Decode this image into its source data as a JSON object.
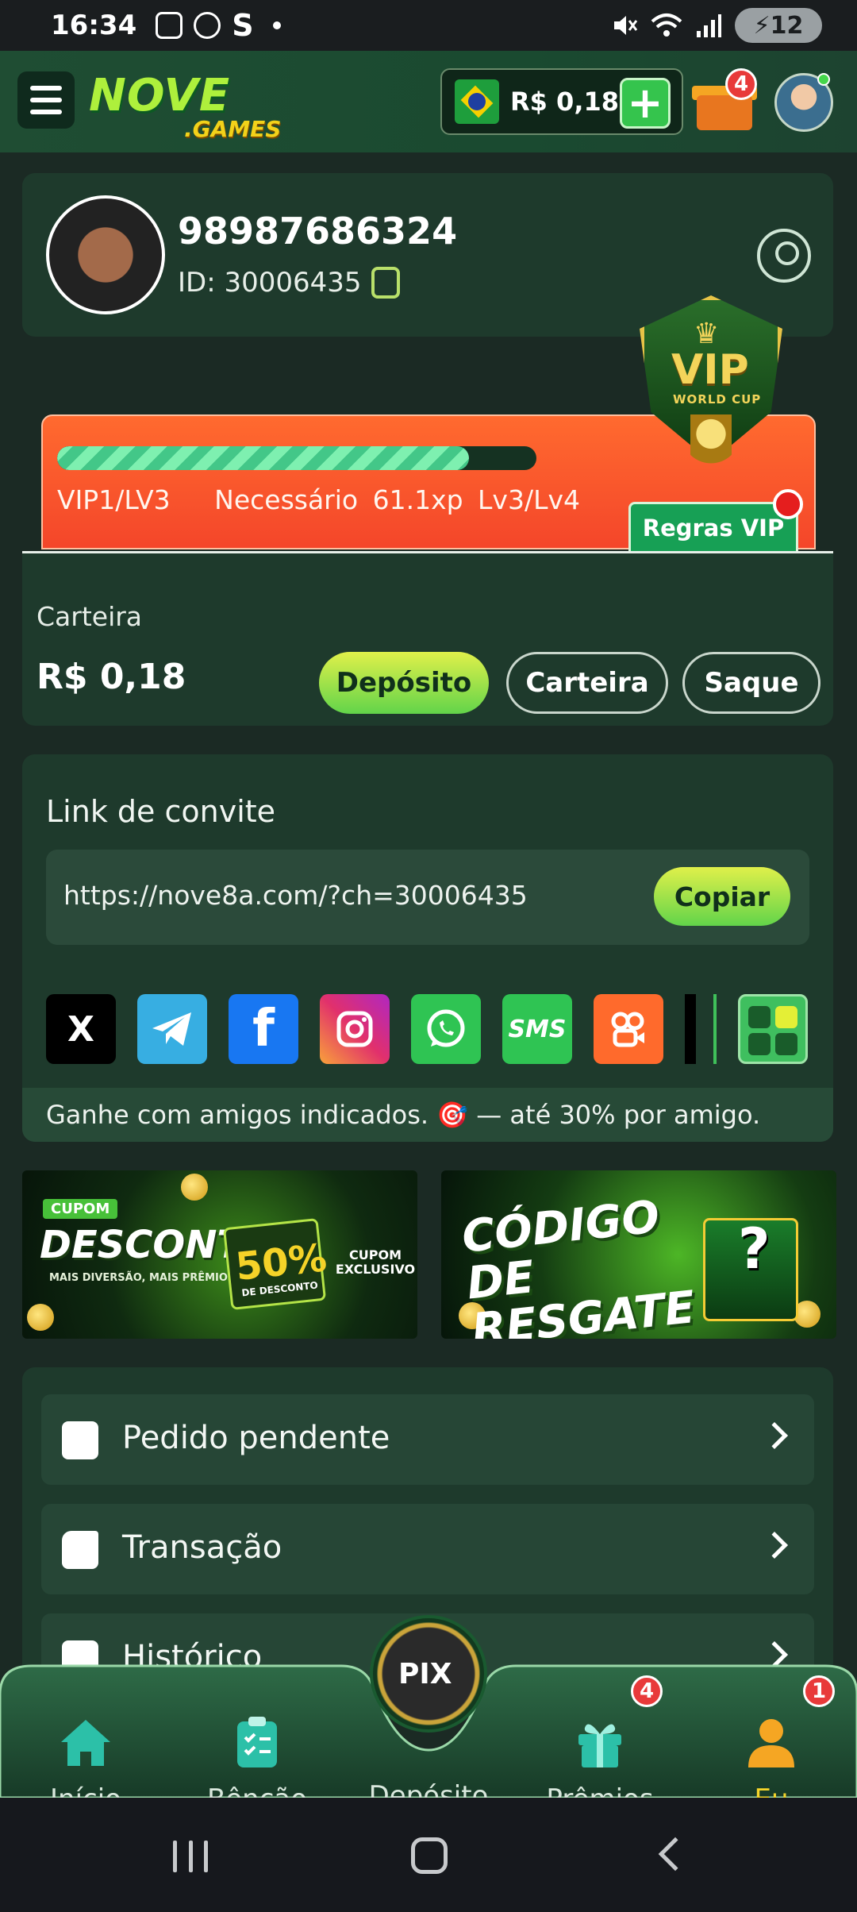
{
  "status_bar": {
    "time": "16:34",
    "left_icons": [
      "gallery-icon",
      "whatsapp-icon"
    ],
    "s_glyph": "S",
    "battery": "12"
  },
  "header": {
    "logo_main": "NOVE",
    "logo_sub": ".GAMES",
    "balance": "R$ 0,18",
    "plus": "+",
    "gift_badge": "4"
  },
  "profile": {
    "name": "98987686324",
    "id": "ID: 30006435"
  },
  "vip": {
    "progress": 0.86,
    "level": "VIP1/LV3",
    "required": "Necessário 61.1xp Lv3/Lv4",
    "rules": "Regras VIP",
    "shield_title": "VIP",
    "shield_sub": "WORLD CUP"
  },
  "wallet": {
    "label": "Carteira",
    "amount": "R$ 0,18",
    "buttons": {
      "deposit": "Depósito",
      "wallet": "Carteira",
      "withdraw": "Saque"
    }
  },
  "invite": {
    "title": "Link de convite",
    "url": "https://nove8a.com/?ch=30006435",
    "copy": "Copiar",
    "share": {
      "x": "X",
      "facebook": "f",
      "sms": "SMS"
    },
    "footer": "Ganhe com amigos indicados. 🎯 — até 30% por amigo."
  },
  "banners": {
    "b1": {
      "tag": "CUPOM",
      "title": "DESCONTO",
      "subtitle": "MAIS DIVERSÃO, MAIS PRÊMIOS!",
      "percent": "50%",
      "percent_label": "DE DESCONTO",
      "cupom": "CUPOM EXCLUSIVO"
    },
    "b2": {
      "title": "CÓDIGO DE RESGATE",
      "mark": "?"
    }
  },
  "menu": {
    "items": [
      {
        "label": "Pedido pendente"
      },
      {
        "label": "Transação"
      },
      {
        "label": "Histórico"
      }
    ]
  },
  "bottom_nav": {
    "items": [
      {
        "label": "Início"
      },
      {
        "label": "Bênção"
      },
      {
        "label": "Depósito"
      },
      {
        "label": "Prêmios",
        "badge": "4"
      },
      {
        "label": "Eu",
        "badge": "1"
      }
    ],
    "pix": "PIX"
  }
}
